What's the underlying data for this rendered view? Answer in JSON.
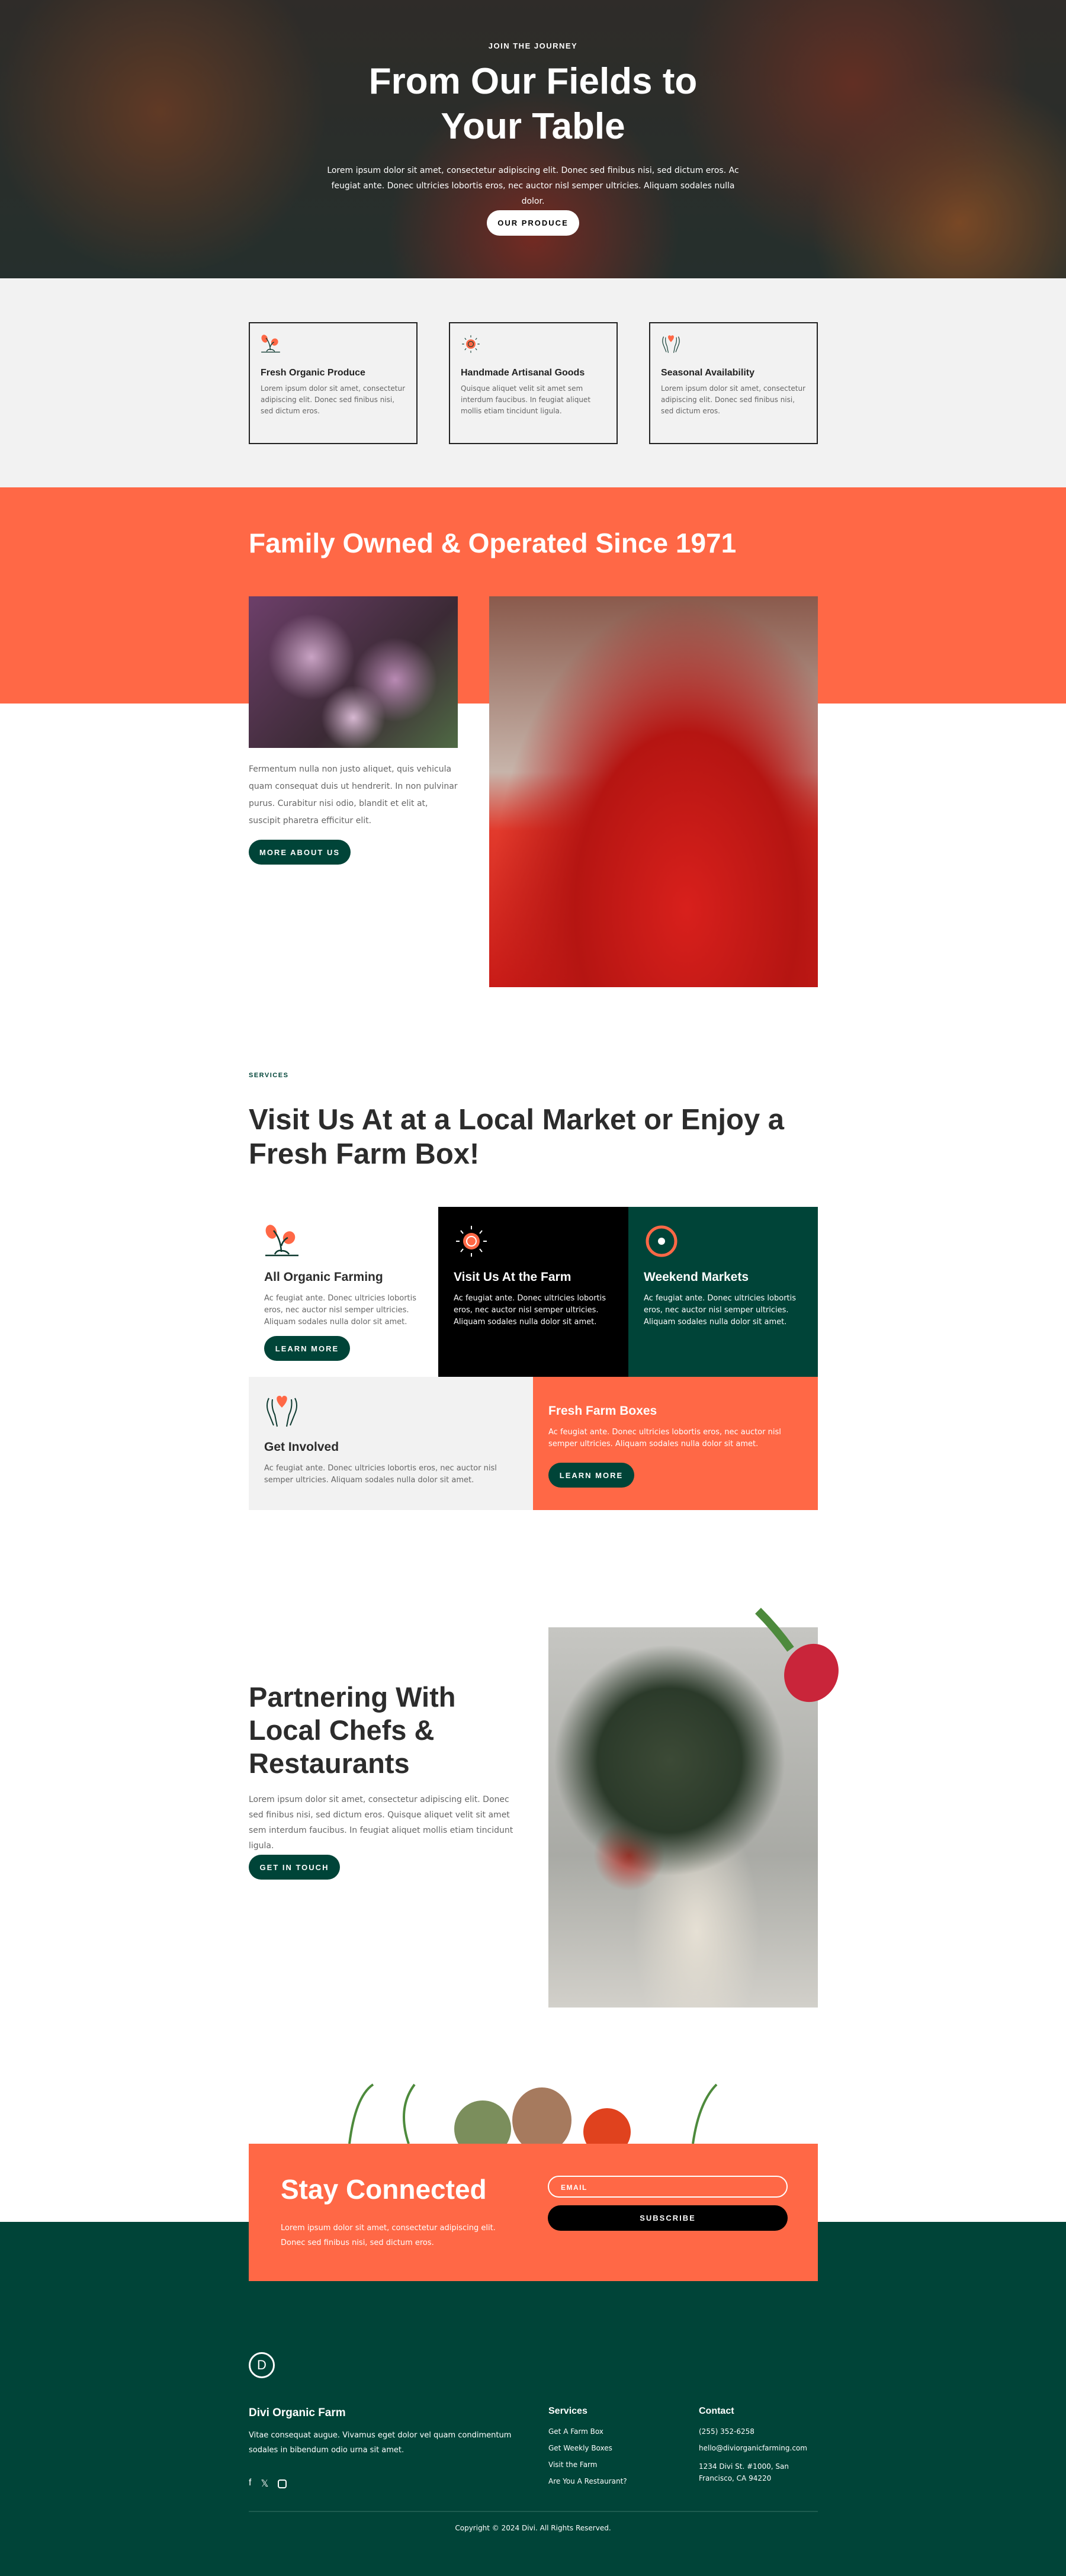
{
  "hero": {
    "eyebrow": "JOIN THE JOURNEY",
    "title_line1": "From Our Fields to",
    "title_line2": "Your Table",
    "text": "Lorem ipsum dolor sit amet, consectetur adipiscing elit. Donec sed finibus nisi, sed dictum eros. Ac feugiat ante. Donec ultricies lobortis eros, nec auctor nisl semper ultricies. Aliquam sodales nulla dolor.",
    "button": "OUR PRODUCE"
  },
  "features": [
    {
      "icon": "sprout-icon",
      "title": "Fresh Organic Produce",
      "text": "Lorem ipsum dolor sit amet, consectetur adipiscing elit. Donec sed finibus nisi, sed dictum eros."
    },
    {
      "icon": "sun-icon",
      "title": "Handmade Artisanal Goods",
      "text": "Quisque aliquet velit sit amet sem interdum faucibus. In feugiat aliquet mollis etiam tincidunt ligula."
    },
    {
      "icon": "hands-heart-icon",
      "title": "Seasonal Availability",
      "text": "Lorem ipsum dolor sit amet, consectetur adipiscing elit. Donec sed finibus nisi, sed dictum eros."
    }
  ],
  "about": {
    "title": "Family Owned & Operated Since 1971",
    "text": "Fermentum nulla non justo aliquet, quis vehicula quam consequat duis ut hendrerit. In non pulvinar purus. Curabitur nisi odio, blandit et elit at, suscipit pharetra efficitur elit.",
    "button": "MORE ABOUT US"
  },
  "services": {
    "eyebrow": "SERVICES",
    "title_line1": "Visit Us At at a Local Market or Enjoy a",
    "title_line2": "Fresh Farm Box!",
    "items": [
      {
        "icon": "sprout-icon",
        "title": "All Organic Farming",
        "text": "Ac feugiat ante. Donec ultricies lobortis eros, nec auctor nisl semper ultricies. Aliquam sodales nulla dolor sit amet.",
        "button": "LEARN MORE"
      },
      {
        "icon": "sun-icon",
        "title": "Visit Us At the Farm",
        "text": "Ac feugiat ante. Donec ultricies lobortis eros, nec auctor nisl semper ultricies. Aliquam sodales nulla dolor sit amet."
      },
      {
        "icon": "location-ring-icon",
        "title": "Weekend Markets",
        "text": "Ac feugiat ante. Donec ultricies lobortis eros, nec auctor nisl semper ultricies. Aliquam sodales nulla dolor sit amet."
      },
      {
        "icon": "hands-heart-icon",
        "title": "Get Involved",
        "text": "Ac feugiat ante. Donec ultricies lobortis eros, nec auctor nisl semper ultricies. Aliquam sodales nulla dolor sit amet."
      },
      {
        "title": "Fresh Farm Boxes",
        "text": "Ac feugiat ante. Donec ultricies lobortis eros, nec auctor nisl semper ultricies. Aliquam sodales nulla dolor sit amet.",
        "button": "LEARN MORE"
      }
    ]
  },
  "partner": {
    "title_line1": "Partnering With",
    "title_line2": "Local Chefs &",
    "title_line3": "Restaurants",
    "text": "Lorem ipsum dolor sit amet, consectetur adipiscing elit. Donec sed finibus nisi, sed dictum eros. Quisque aliquet velit sit amet sem interdum faucibus. In feugiat aliquet mollis etiam tincidunt ligula.",
    "button": "GET IN TOUCH"
  },
  "newsletter": {
    "title": "Stay Connected",
    "text": "Lorem ipsum dolor sit amet, consectetur adipiscing elit. Donec sed finibus nisi, sed dictum eros.",
    "email_placeholder": "EMAIL",
    "button": "SUBSCRIBE"
  },
  "footer": {
    "logo": "D",
    "brand": "Divi Organic Farm",
    "text": "Vitae consequat augue. Vivamus eget dolor vel quam condimentum sodales in bibendum odio urna sit amet.",
    "services_title": "Services",
    "services": [
      "Get A Farm Box",
      "Get Weekly Boxes",
      "Visit the Farm",
      "Are You A Restaurant?"
    ],
    "contact_title": "Contact",
    "phone": "(255) 352-6258",
    "email": "hello@diviorganicfarming.com",
    "address": "1234 Divi St. #1000, San Francisco, CA 94220",
    "copyright": "Copyright © 2024 Divi. All Rights Reserved.",
    "social": [
      "facebook-icon",
      "x-icon",
      "instagram-icon"
    ]
  },
  "colors": {
    "accent": "#ff6846",
    "green": "#004438",
    "black": "#000000",
    "light": "#f2f2f2"
  }
}
